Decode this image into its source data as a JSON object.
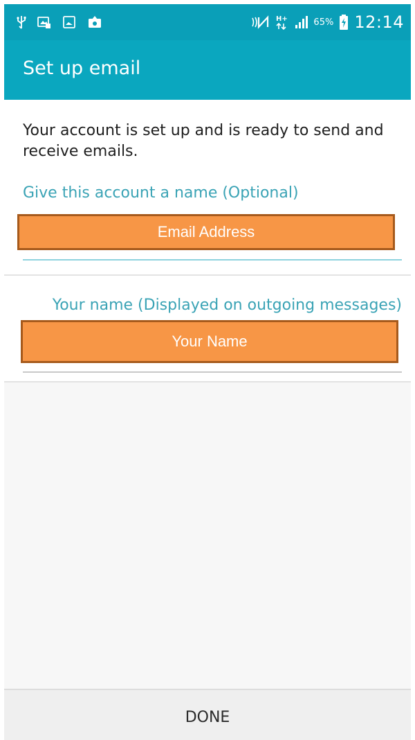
{
  "status_bar": {
    "left_icons": [
      "usb-icon",
      "screenshot-icon",
      "gallery-icon",
      "photo-upload-icon"
    ],
    "right_icons": [
      "nfc-icon",
      "hplus-data-icon",
      "signal-icon",
      "battery-charging-icon"
    ],
    "network_label": "H+",
    "battery_percent": "65%",
    "time": "12:14"
  },
  "title_bar": {
    "title": "Set up email"
  },
  "content": {
    "message": "Your account is set up and is ready to send and receive emails.",
    "account_name_label": "Give this account a name (Optional)",
    "account_name_value": "Email Address",
    "your_name_label": "Your name (Displayed on outgoing messages)",
    "your_name_value": "Your Name"
  },
  "footer": {
    "done_label": "DONE"
  },
  "colors": {
    "status_bar": "#0a9fb8",
    "title_bar": "#0aa7bf",
    "accent": "#3aa3b5",
    "orange_fill": "#f79646",
    "orange_border": "#a65a1c"
  }
}
